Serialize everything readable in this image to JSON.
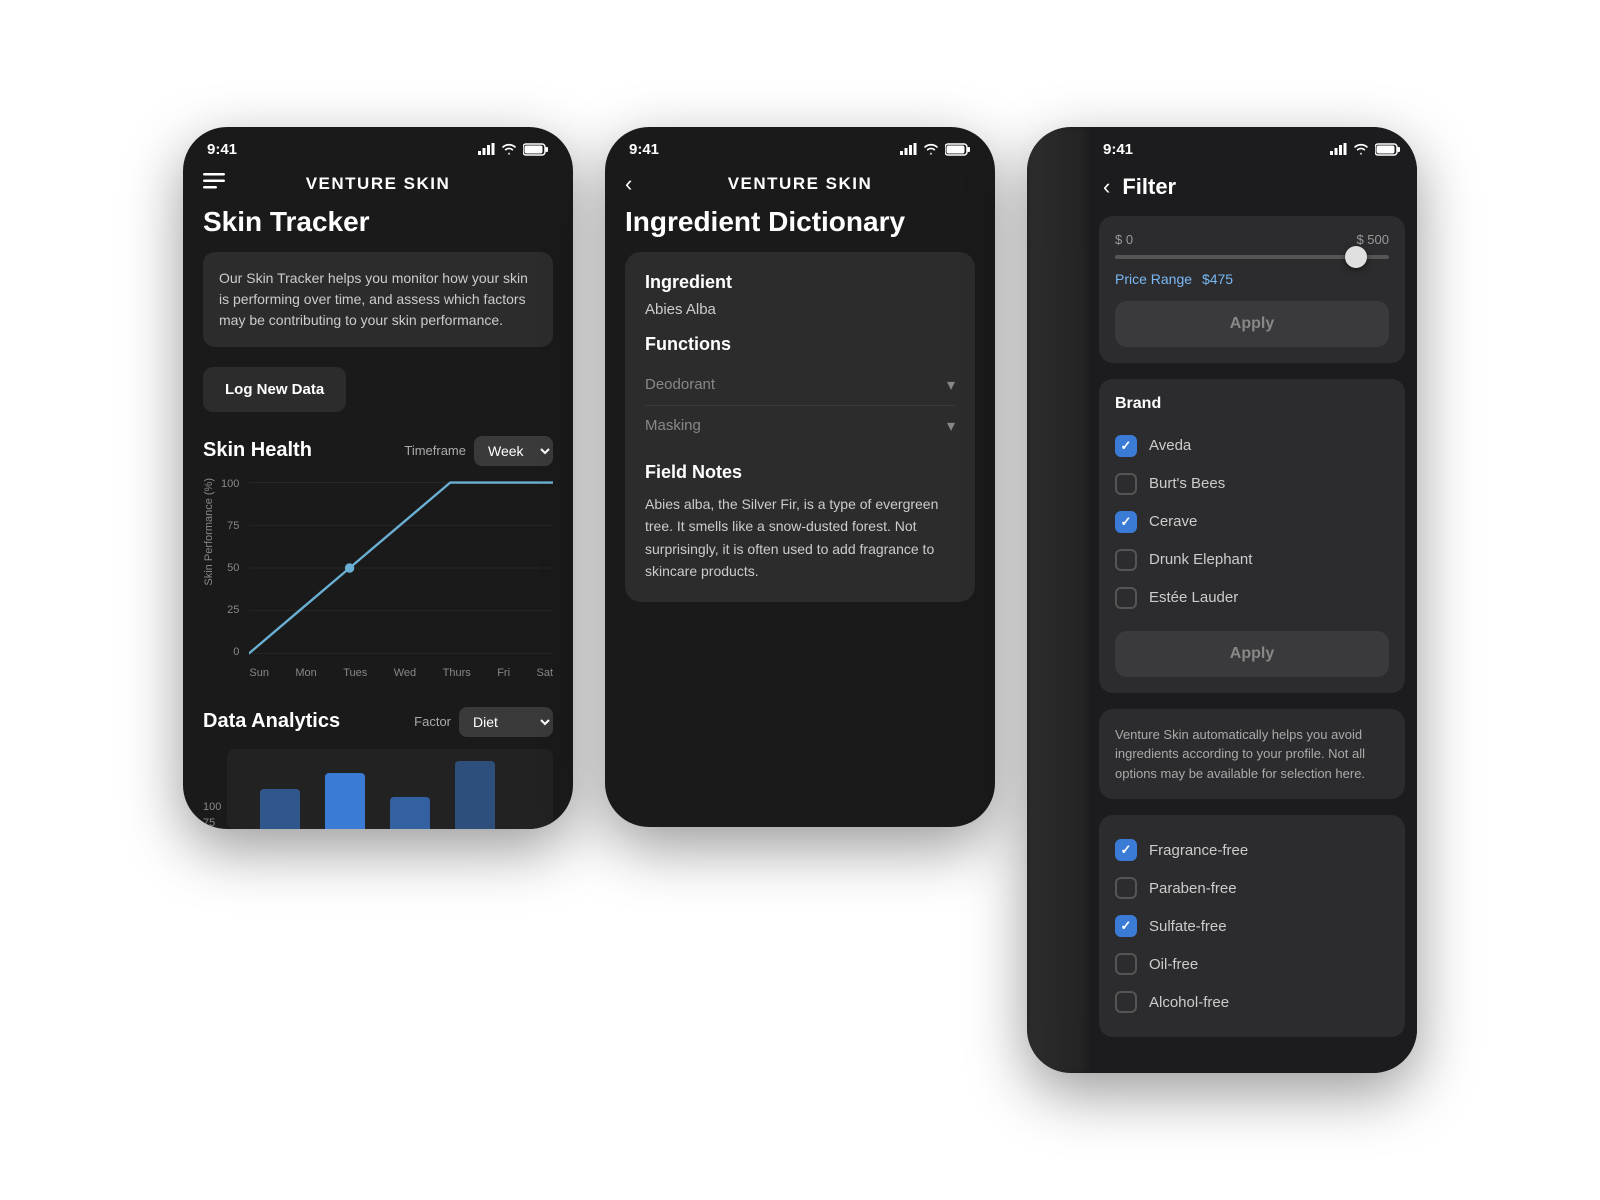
{
  "screen1": {
    "status_time": "9:41",
    "app_title": "VENTURE SKIN",
    "page_title": "Skin Tracker",
    "description": "Our Skin Tracker helps you monitor how your skin is performing over time, and assess which factors may be contributing to your skin performance.",
    "log_btn_label": "Log New Data",
    "skin_health_title": "Skin Health",
    "timeframe_label": "Timeframe",
    "timeframe_value": "Week",
    "chart_y_label": "Skin Performance (%)",
    "chart_y_ticks": [
      "100",
      "75",
      "50",
      "25",
      "0"
    ],
    "chart_x_days": [
      "Sun",
      "Mon",
      "Tues",
      "Wed",
      "Thurs",
      "Fri",
      "Sat"
    ],
    "data_analytics_title": "Data Analytics",
    "factor_label": "Factor",
    "factor_value": "Diet"
  },
  "screen2": {
    "status_time": "9:41",
    "app_title": "VENTURE SKIN",
    "page_title": "Ingredient Dictionary",
    "ingredient_label": "Ingredient",
    "ingredient_name": "Abies Alba",
    "functions_label": "Functions",
    "function1": "Deodorant",
    "function2": "Masking",
    "field_notes_label": "Field Notes",
    "field_notes_text": "Abies alba, the Silver Fir, is a type of evergreen tree. It smells like a snow-dusted forest. Not surprisingly, it is often used to add fragrance to skincare products."
  },
  "screen3": {
    "status_time": "9:41",
    "filter_title": "Filter",
    "price_min": "$ 0",
    "price_max": "$ 500",
    "price_range_label": "Price Range",
    "price_value": "$475",
    "apply_btn1": "Apply",
    "brand_title": "Brand",
    "brands": [
      {
        "name": "Aveda",
        "checked": true
      },
      {
        "name": "Burt's Bees",
        "checked": false
      },
      {
        "name": "Cerave",
        "checked": true
      },
      {
        "name": "Drunk Elephant",
        "checked": false
      },
      {
        "name": "Estée Lauder",
        "checked": false
      }
    ],
    "apply_btn2": "Apply",
    "info_text": "Venture Skin automatically helps you avoid ingredients according to your profile. Not all options may be available for selection here.",
    "toggles": [
      {
        "label": "Fragrance-free",
        "checked": true
      },
      {
        "label": "Paraben-free",
        "checked": false
      },
      {
        "label": "Sulfate-free",
        "checked": true
      },
      {
        "label": "Oil-free",
        "checked": false
      },
      {
        "label": "Alcohol-free",
        "checked": false
      }
    ]
  }
}
